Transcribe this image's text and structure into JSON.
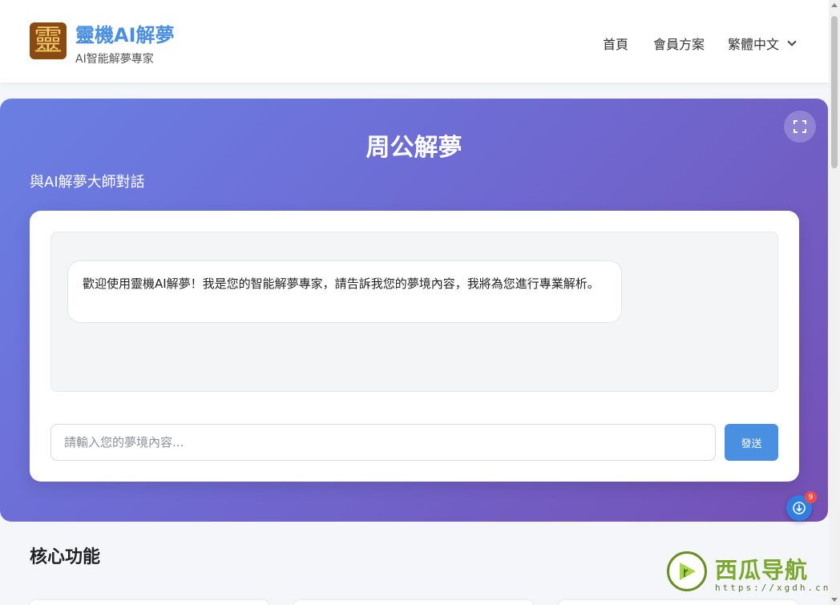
{
  "header": {
    "logo_glyph": "靈",
    "brand_title": "靈機AI解夢",
    "brand_subtitle": "AI智能解夢專家",
    "nav": {
      "home": "首頁",
      "plans": "會員方案",
      "language": "繁體中文"
    }
  },
  "hero": {
    "title": "周公解夢",
    "subtitle": "與AI解夢大師對話",
    "welcome_message": "歡迎使用靈機AI解夢！我是您的智能解夢專家，請告訴我您的夢境內容，我將為您進行專業解析。",
    "input_placeholder": "請輸入您的夢境內容...",
    "send_label": "發送",
    "badge_count": "9"
  },
  "features": {
    "title": "核心功能"
  },
  "watermark": {
    "name": "西瓜导航",
    "url": "https://xgdh.cn"
  },
  "colors": {
    "brand_blue": "#4a90e2",
    "hero_gradient_start": "#6a7fe3",
    "hero_gradient_end": "#7550b4",
    "logo_bg": "#8a4b12"
  }
}
